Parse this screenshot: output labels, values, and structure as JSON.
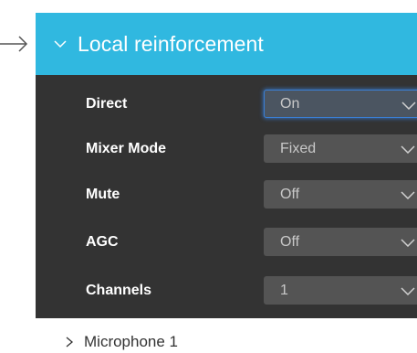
{
  "panel": {
    "title": "Local reinforcement",
    "expanded": true,
    "header_color": "#30b8e0",
    "body_color": "#333333",
    "header_icon": "chevron-down-icon"
  },
  "pointer_icon": "arrow-right-icon",
  "settings": [
    {
      "label": "Direct",
      "value": "On",
      "focused": true
    },
    {
      "label": "Mixer Mode",
      "value": "Fixed"
    },
    {
      "label": "Mute",
      "value": "Off"
    },
    {
      "label": "AGC",
      "value": "Off"
    },
    {
      "label": "Channels",
      "value": "1"
    }
  ],
  "subsection": {
    "label": "Microphone 1",
    "icon": "chevron-right-icon"
  }
}
